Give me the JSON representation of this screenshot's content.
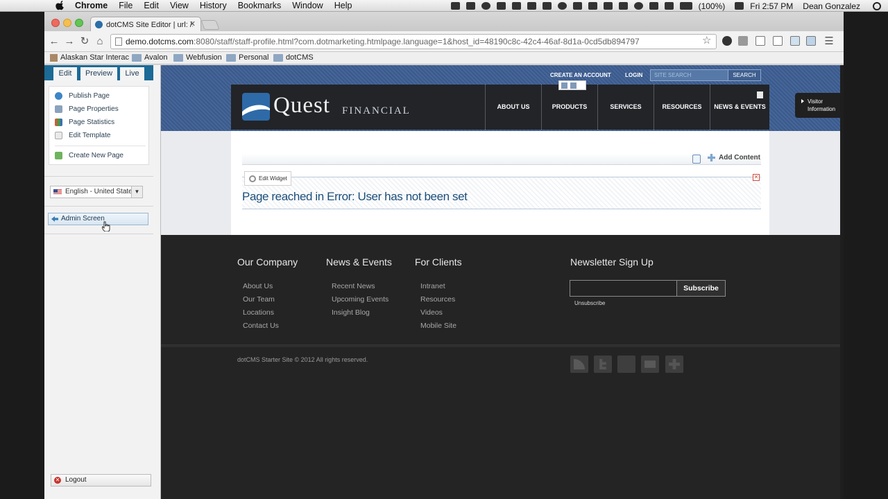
{
  "menubar": {
    "app_name": "Chrome",
    "items": [
      "File",
      "Edit",
      "View",
      "History",
      "Bookmarks",
      "Window",
      "Help"
    ],
    "battery": "(100%)",
    "clock": "Fri 2:57 PM",
    "user": "Dean Gonzalez"
  },
  "browser": {
    "tab_title": "dotCMS Site Editor | url: /sta",
    "url_host": "demo.dotcms.com",
    "url_rest": ":8080/staff/staff-profile.html?com.dotmarketing.htmlpage.language=1&host_id=48190c8c-42c4-46af-8d1a-0cd5db894797",
    "bookmarks": [
      {
        "label": "Alaskan Star Interac",
        "icon": "site-favicon"
      },
      {
        "label": "Avalon",
        "icon": "folder-icon"
      },
      {
        "label": "Webfusion",
        "icon": "folder-icon"
      },
      {
        "label": "Personal",
        "icon": "folder-icon"
      },
      {
        "label": "dotCMS",
        "icon": "folder-icon"
      }
    ]
  },
  "cms_sidebar": {
    "tabs": {
      "edit": "Edit",
      "preview": "Preview",
      "live": "Live"
    },
    "actions": {
      "publish": "Publish Page",
      "properties": "Page Properties",
      "statistics": "Page Statistics",
      "edit_template": "Edit Template",
      "create_page": "Create New Page"
    },
    "language": "English - United States",
    "admin_screen": "Admin Screen",
    "logout": "Logout"
  },
  "site": {
    "top_links": {
      "create_account": "CREATE AN ACCOUNT",
      "login": "LOGIN"
    },
    "search_placeholder": "SITE SEARCH",
    "search_button": "SEARCH",
    "logo_main": "Quest",
    "logo_sub": "FINANCIAL",
    "nav": {
      "about": "ABOUT US",
      "products": "PRODUCTS",
      "services": "SERVICES",
      "resources": "RESOURCES",
      "news": "NEWS & EVENTS"
    },
    "visitor": {
      "line1": "Visitor",
      "line2": "Information"
    },
    "add_content": "Add Content",
    "edit_widget": "Edit Widget",
    "error_message": "Page reached in Error: User has not been set"
  },
  "footer": {
    "company": {
      "heading": "Our Company",
      "links": [
        "About Us",
        "Our Team",
        "Locations",
        "Contact Us"
      ]
    },
    "news": {
      "heading": "News & Events",
      "links": [
        "Recent News",
        "Upcoming Events",
        "Insight Blog"
      ]
    },
    "clients": {
      "heading": "For Clients",
      "links": [
        "Intranet",
        "Resources",
        "Videos",
        "Mobile Site"
      ]
    },
    "newsletter": {
      "heading": "Newsletter Sign Up",
      "subscribe": "Subscribe",
      "unsubscribe": "Unsubscribe"
    },
    "copyright": "dotCMS Starter Site © 2012 All rights reserved.",
    "social_icons": [
      "rss-icon",
      "twitter-icon",
      "facebook-icon",
      "email-icon",
      "plus-icon"
    ]
  },
  "colors": {
    "header_blue": "#3b5a8a",
    "cms_tab_blue": "#1c6a96",
    "footer_bg": "#242424",
    "error_text": "#1d4e7a"
  }
}
